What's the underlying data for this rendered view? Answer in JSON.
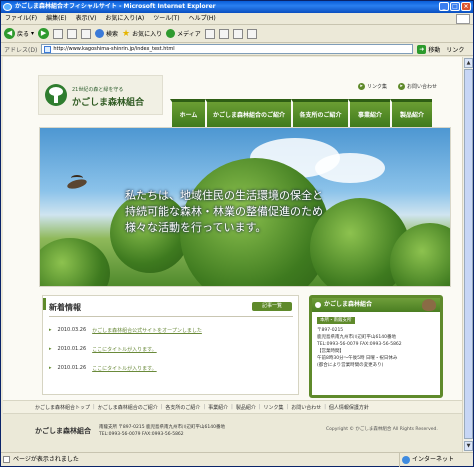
{
  "window": {
    "title": "かごしま森林組合オフィシャルサイト - Microsoft Internet Explorer",
    "controls": [
      "_",
      "□",
      "×"
    ]
  },
  "menubar": [
    "ファイル(F)",
    "編集(E)",
    "表示(V)",
    "お気に入り(A)",
    "ツール(T)",
    "ヘルプ(H)"
  ],
  "toolbar": {
    "back": "戻る",
    "search": "検索",
    "favorites": "お気に入り",
    "media": "メディア"
  },
  "addressbar": {
    "label": "アドレス(D)",
    "url": "http://www.kagoshima-shinrin.jp/index_test.html",
    "go": "移動",
    "links": "リンク"
  },
  "site": {
    "logo_sub": "21世紀の森と緑を守る",
    "logo_name": "かごしま森林組合",
    "sitemap": "リンク集",
    "contact": "お問い合わせ",
    "nav": [
      "ホーム",
      "かごしま森林組合のご紹介",
      "各支所のご紹介",
      "事業紹介",
      "製品紹介"
    ],
    "hero_message": "私たちは、地域住民の生活環境の保全と\n持続可能な森林・林業の整備促進のため\n様々な活動を行っています。",
    "news": {
      "title": "新着情報",
      "more": "記事一覧",
      "items": [
        {
          "date": "2010.03.26",
          "text": "かごしま森林組合公式サイトをオープンしました"
        },
        {
          "date": "2010.01.26",
          "text": "ここにタイトルが入ります。"
        },
        {
          "date": "2010.01.26",
          "text": "ここにタイトルが入ります。"
        }
      ]
    },
    "office": {
      "title": "かごしま森林組合",
      "tag": "本所・南薩支所",
      "info": "〒897-0215\n鹿児島県南九州市川辺町平山6140番地\nTEL:0993-56-0079 FAX:0993-56-5862\n【営業時間】\n午前8時30分〜午後5時 日曜・祝日休み\n(都合により営業時間の変更あり)"
    },
    "footer_nav": [
      "かごしま森林組合トップ",
      "かごしま森林組合のご紹介",
      "各支所のご紹介",
      "事業紹介",
      "製品紹介",
      "リンク集",
      "お問い合わせ",
      "個人情報保護方針"
    ],
    "footer": {
      "name": "かごしま森林組合",
      "address": "南薩支所 〒897-0215 鹿児島県南九州市川辺町平山6140番地\nTEL:0993-56-0079 FAX:0993-56-5862",
      "copyright": "Copyright © かごしま森林組合 All Rights Reserved."
    }
  },
  "status": {
    "text": "ページが表示されました",
    "zone": "インターネット"
  },
  "colors": {
    "brand_green": "#5f8a2b",
    "nav_green": "#4f8a25",
    "title_blue": "#0a5ed8"
  }
}
